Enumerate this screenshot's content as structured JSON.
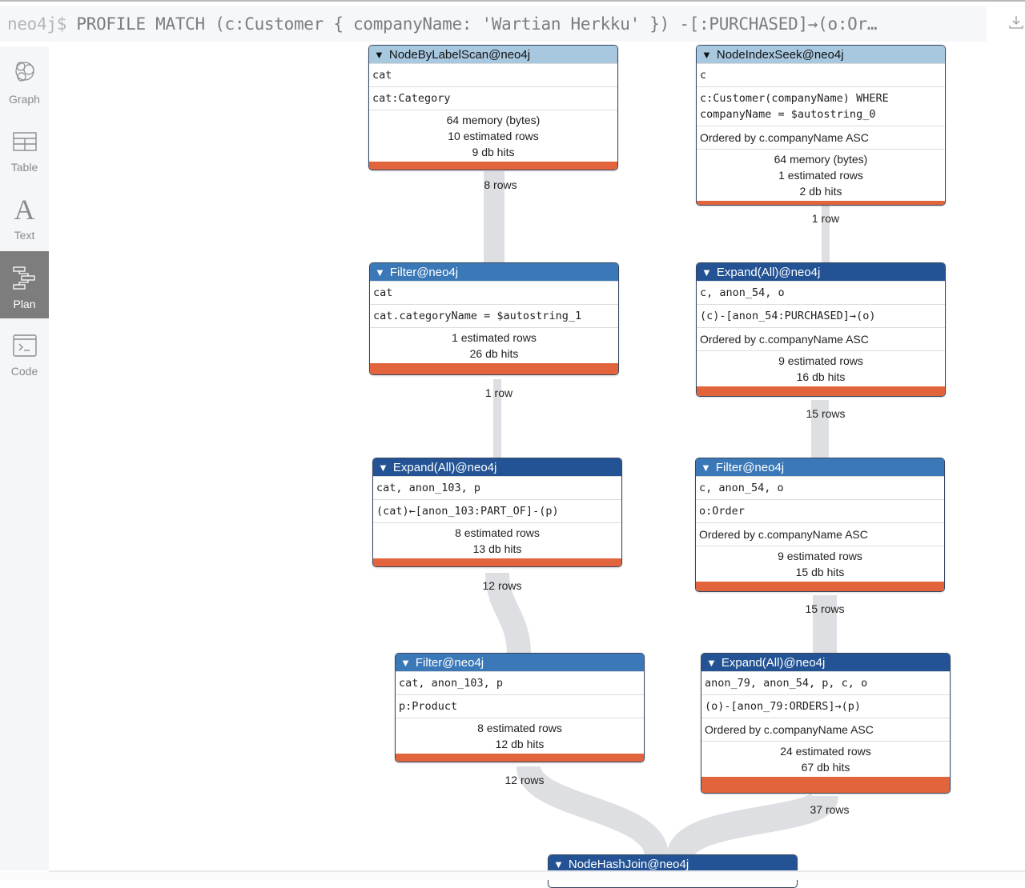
{
  "command": {
    "prompt": "neo4j$",
    "query": "PROFILE MATCH (c:Customer { companyName: 'Wartian Herkku' }) -[:PURCHASED]→(o:Or…",
    "download_icon": "download-icon"
  },
  "sidebar": {
    "items": [
      {
        "label": "Graph",
        "icon": "graph-icon",
        "active": false
      },
      {
        "label": "Table",
        "icon": "table-icon",
        "active": false
      },
      {
        "label": "Text",
        "icon": "text-icon",
        "active": false
      },
      {
        "label": "Plan",
        "icon": "plan-icon",
        "active": true
      },
      {
        "label": "Code",
        "icon": "code-icon",
        "active": false
      }
    ]
  },
  "plan": {
    "operators": [
      {
        "id": "nblscan",
        "title": "NodeByLabelScan@neo4j",
        "rows_mono": [
          "cat",
          "cat:Category"
        ],
        "ordered": null,
        "stats": [
          "64 memory (bytes)",
          "10 estimated rows",
          "9 db hits"
        ],
        "output": "8 rows"
      },
      {
        "id": "nis",
        "title": "NodeIndexSeek@neo4j",
        "rows_mono": [
          "c",
          "c:Customer(companyName) WHERE\ncompanyName = $autostring_0"
        ],
        "ordered": "Ordered by c.companyName ASC",
        "stats": [
          "64 memory (bytes)",
          "1 estimated rows",
          "2 db hits"
        ],
        "output": "1 row"
      },
      {
        "id": "filter1",
        "title": "Filter@neo4j",
        "rows_mono": [
          "cat",
          "cat.categoryName = $autostring_1"
        ],
        "ordered": null,
        "stats": [
          "1 estimated rows",
          "26 db hits"
        ],
        "output": "1 row"
      },
      {
        "id": "expand1",
        "title": "Expand(All)@neo4j",
        "rows_mono": [
          "c, anon_54, o",
          "(c)-[anon_54:PURCHASED]→(o)"
        ],
        "ordered": "Ordered by c.companyName ASC",
        "stats": [
          "9 estimated rows",
          "16 db hits"
        ],
        "output": "15 rows"
      },
      {
        "id": "expand2",
        "title": "Expand(All)@neo4j",
        "rows_mono": [
          "cat, anon_103, p",
          "(cat)←[anon_103:PART_OF]-(p)"
        ],
        "ordered": null,
        "stats": [
          "8 estimated rows",
          "13 db hits"
        ],
        "output": "12 rows"
      },
      {
        "id": "filter2",
        "title": "Filter@neo4j",
        "rows_mono": [
          "c, anon_54, o",
          "o:Order"
        ],
        "ordered": "Ordered by c.companyName ASC",
        "stats": [
          "9 estimated rows",
          "15 db hits"
        ],
        "output": "15 rows"
      },
      {
        "id": "filter3",
        "title": "Filter@neo4j",
        "rows_mono": [
          "cat, anon_103, p",
          "p:Product"
        ],
        "ordered": null,
        "stats": [
          "8 estimated rows",
          "12 db hits"
        ],
        "output": "12 rows"
      },
      {
        "id": "expand3",
        "title": "Expand(All)@neo4j",
        "rows_mono": [
          "anon_79, anon_54, p, c, o",
          "(o)-[anon_79:ORDERS]→(p)"
        ],
        "ordered": "Ordered by c.companyName ASC",
        "stats": [
          "24 estimated rows",
          "67 db hits"
        ],
        "output": "37 rows"
      },
      {
        "id": "hashjoin",
        "title": "NodeHashJoin@neo4j",
        "rows_mono": [],
        "ordered": null,
        "stats": [],
        "output": null
      }
    ]
  },
  "colors": {
    "leaf_header": "#a8c8e0",
    "filter_header": "#3a78b8",
    "expand_header": "#235394",
    "cost_bar": "#e2643c",
    "flow": "#dedfe2",
    "sidebar_active": "#7d7d7d"
  }
}
